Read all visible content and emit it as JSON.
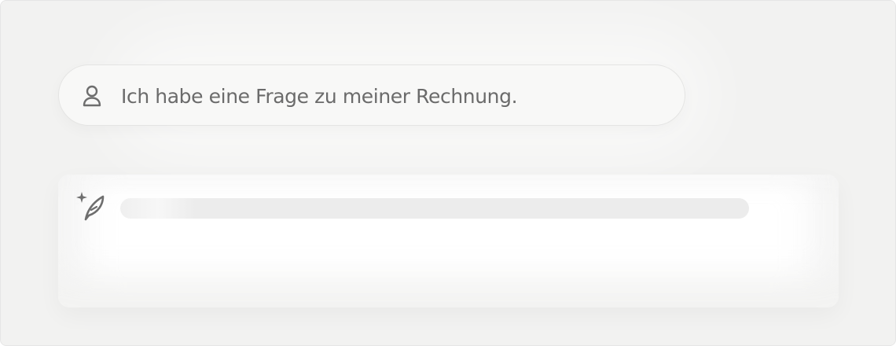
{
  "conversation": {
    "user_message": {
      "icon": "person-icon",
      "text": "Ich habe eine Frage zu meiner Rechnung."
    },
    "assistant_reply": {
      "icon": "sparkle-quill-icon",
      "state": "loading"
    }
  },
  "colors": {
    "background": "#f2f2f1",
    "user_bubble": "#f8f8f7",
    "reply_card": "#ffffff",
    "text": "#6b6b6b",
    "icon": "#6e6e6e",
    "skeleton": "#ececec"
  }
}
